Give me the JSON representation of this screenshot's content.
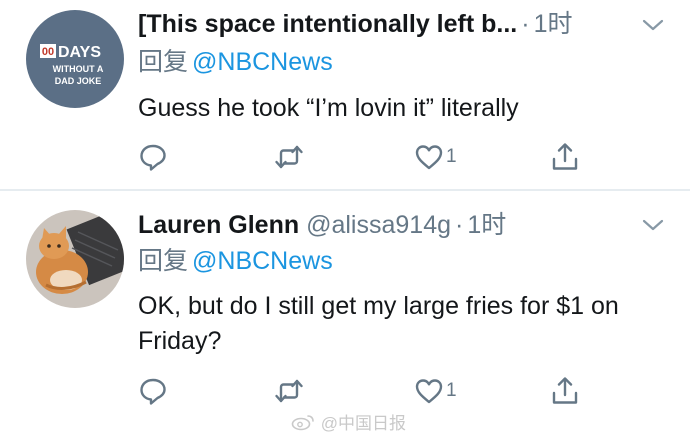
{
  "tweets": [
    {
      "display_name": "[This space intentionally left b...",
      "handle": "",
      "time": "1时",
      "reply_prefix": "回复",
      "reply_to": "@NBCNews",
      "text": "Guess he took “I’m lovin it” literally",
      "likes": "1",
      "avatar_text": {
        "counter": "00",
        "big": "DAYS",
        "line2": "WITHOUT A",
        "line3": "DAD JOKE"
      }
    },
    {
      "display_name": "Lauren Glenn",
      "handle": "@alissa914g",
      "time": "1时",
      "reply_prefix": "回复",
      "reply_to": "@NBCNews",
      "text": "OK, but do I still get my large fries for $1 on Friday?",
      "likes": "1"
    }
  ],
  "watermark": "@中国日报",
  "icons": [
    "reply-icon",
    "retweet-icon",
    "like-icon",
    "share-icon",
    "chevron-down-icon",
    "weibo-icon"
  ],
  "colors": {
    "text": "#14171a",
    "secondary": "#657786",
    "link": "#1b95e0",
    "divider": "#e6ecf0"
  }
}
